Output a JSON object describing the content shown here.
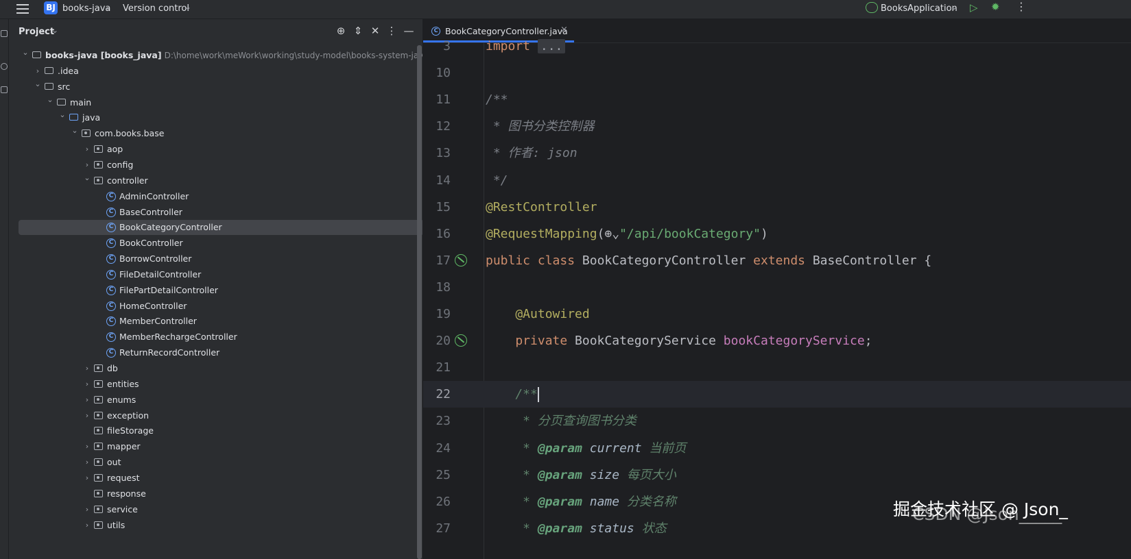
{
  "titlebar": {
    "project_badge": "BJ",
    "project_name": "books-java",
    "vcs_label": "Version control",
    "run_config": "BooksApplication"
  },
  "project_panel": {
    "title": "Project",
    "tree": [
      {
        "label": "books-java [books_java]",
        "path": "D:\\home\\work\\meWork\\working\\study-model\\books-system-java\\books",
        "depth": 0,
        "kind": "module",
        "expanded": true
      },
      {
        "label": ".idea",
        "depth": 1,
        "kind": "folder",
        "expanded": false
      },
      {
        "label": "src",
        "depth": 1,
        "kind": "folder",
        "expanded": true
      },
      {
        "label": "main",
        "depth": 2,
        "kind": "folder",
        "expanded": true
      },
      {
        "label": "java",
        "depth": 3,
        "kind": "source-folder",
        "expanded": true
      },
      {
        "label": "com.books.base",
        "depth": 4,
        "kind": "package",
        "expanded": true
      },
      {
        "label": "aop",
        "depth": 5,
        "kind": "package",
        "expanded": false
      },
      {
        "label": "config",
        "depth": 5,
        "kind": "package",
        "expanded": false
      },
      {
        "label": "controller",
        "depth": 5,
        "kind": "package",
        "expanded": true
      },
      {
        "label": "AdminController",
        "depth": 6,
        "kind": "class"
      },
      {
        "label": "BaseController",
        "depth": 6,
        "kind": "class"
      },
      {
        "label": "BookCategoryController",
        "depth": 6,
        "kind": "class",
        "selected": true
      },
      {
        "label": "BookController",
        "depth": 6,
        "kind": "class"
      },
      {
        "label": "BorrowController",
        "depth": 6,
        "kind": "class"
      },
      {
        "label": "FileDetailController",
        "depth": 6,
        "kind": "class"
      },
      {
        "label": "FilePartDetailController",
        "depth": 6,
        "kind": "class"
      },
      {
        "label": "HomeController",
        "depth": 6,
        "kind": "class"
      },
      {
        "label": "MemberController",
        "depth": 6,
        "kind": "class"
      },
      {
        "label": "MemberRechargeController",
        "depth": 6,
        "kind": "class"
      },
      {
        "label": "ReturnRecordController",
        "depth": 6,
        "kind": "class"
      },
      {
        "label": "db",
        "depth": 5,
        "kind": "package",
        "expanded": false
      },
      {
        "label": "entities",
        "depth": 5,
        "kind": "package",
        "expanded": false
      },
      {
        "label": "enums",
        "depth": 5,
        "kind": "package",
        "expanded": false
      },
      {
        "label": "exception",
        "depth": 5,
        "kind": "package",
        "expanded": false
      },
      {
        "label": "fileStorage",
        "depth": 5,
        "kind": "package",
        "leaf": true
      },
      {
        "label": "mapper",
        "depth": 5,
        "kind": "package",
        "expanded": false
      },
      {
        "label": "out",
        "depth": 5,
        "kind": "package",
        "expanded": false
      },
      {
        "label": "request",
        "depth": 5,
        "kind": "package",
        "expanded": false
      },
      {
        "label": "response",
        "depth": 5,
        "kind": "package",
        "leaf": true
      },
      {
        "label": "service",
        "depth": 5,
        "kind": "package",
        "expanded": false
      },
      {
        "label": "utils",
        "depth": 5,
        "kind": "package",
        "expanded": false
      }
    ]
  },
  "editor": {
    "tab_label": "BookCategoryController.java",
    "current_line": "22",
    "lines": [
      {
        "no": "3",
        "segments": [
          {
            "c": "kw",
            "t": "import "
          },
          {
            "c": "fold",
            "t": "..."
          }
        ]
      },
      {
        "no": "10",
        "segments": []
      },
      {
        "no": "11",
        "segments": [
          {
            "c": "cmt",
            "t": "/**"
          }
        ]
      },
      {
        "no": "12",
        "segments": [
          {
            "c": "cmt",
            "t": " * 图书分类控制器"
          }
        ]
      },
      {
        "no": "13",
        "segments": [
          {
            "c": "cmt",
            "t": " * 作者: json"
          }
        ]
      },
      {
        "no": "14",
        "segments": [
          {
            "c": "cmt",
            "t": " */"
          }
        ]
      },
      {
        "no": "15",
        "segments": [
          {
            "c": "ann",
            "t": "@RestController"
          }
        ]
      },
      {
        "no": "16",
        "segments": [
          {
            "c": "ann",
            "t": "@RequestMapping"
          },
          {
            "c": "plain",
            "t": "(⊕⌄"
          },
          {
            "c": "str",
            "t": "\"/api/bookCategory\""
          },
          {
            "c": "plain",
            "t": ")"
          }
        ]
      },
      {
        "no": "17",
        "gutter": true,
        "segments": [
          {
            "c": "kw",
            "t": "public class "
          },
          {
            "c": "plain",
            "t": "BookCategoryController "
          },
          {
            "c": "kw",
            "t": "extends "
          },
          {
            "c": "plain",
            "t": "BaseController {"
          }
        ]
      },
      {
        "no": "18",
        "segments": []
      },
      {
        "no": "19",
        "segments": [
          {
            "c": "ann",
            "t": "    @Autowired"
          }
        ]
      },
      {
        "no": "20",
        "gutter": true,
        "segments": [
          {
            "c": "kw",
            "t": "    private "
          },
          {
            "c": "plain",
            "t": "BookCategoryService "
          },
          {
            "c": "field",
            "t": "bookCategoryService"
          },
          {
            "c": "plain",
            "t": ";"
          }
        ]
      },
      {
        "no": "21",
        "segments": []
      },
      {
        "no": "22",
        "segments": [
          {
            "c": "doc",
            "t": "    /**"
          }
        ],
        "caret": true
      },
      {
        "no": "23",
        "segments": [
          {
            "c": "doc",
            "t": "     * 分页查询图书分类"
          }
        ]
      },
      {
        "no": "24",
        "segments": [
          {
            "c": "doc",
            "t": "     * "
          },
          {
            "c": "doctag",
            "t": "@param"
          },
          {
            "c": "docparam",
            "t": " current"
          },
          {
            "c": "doc",
            "t": " 当前页"
          }
        ]
      },
      {
        "no": "25",
        "segments": [
          {
            "c": "doc",
            "t": "     * "
          },
          {
            "c": "doctag",
            "t": "@param"
          },
          {
            "c": "docparam",
            "t": " size"
          },
          {
            "c": "doc",
            "t": " 每页大小"
          }
        ]
      },
      {
        "no": "26",
        "segments": [
          {
            "c": "doc",
            "t": "     * "
          },
          {
            "c": "doctag",
            "t": "@param"
          },
          {
            "c": "docparam",
            "t": " name"
          },
          {
            "c": "doc",
            "t": " 分类名称"
          }
        ]
      },
      {
        "no": "27",
        "segments": [
          {
            "c": "doc",
            "t": "     * "
          },
          {
            "c": "doctag",
            "t": "@param"
          },
          {
            "c": "docparam",
            "t": " status"
          },
          {
            "c": "doc",
            "t": " 状态"
          }
        ]
      }
    ]
  },
  "watermark": {
    "text": "掘金技术社区 @ Json_",
    "text2": "CSDN @Json_____"
  }
}
